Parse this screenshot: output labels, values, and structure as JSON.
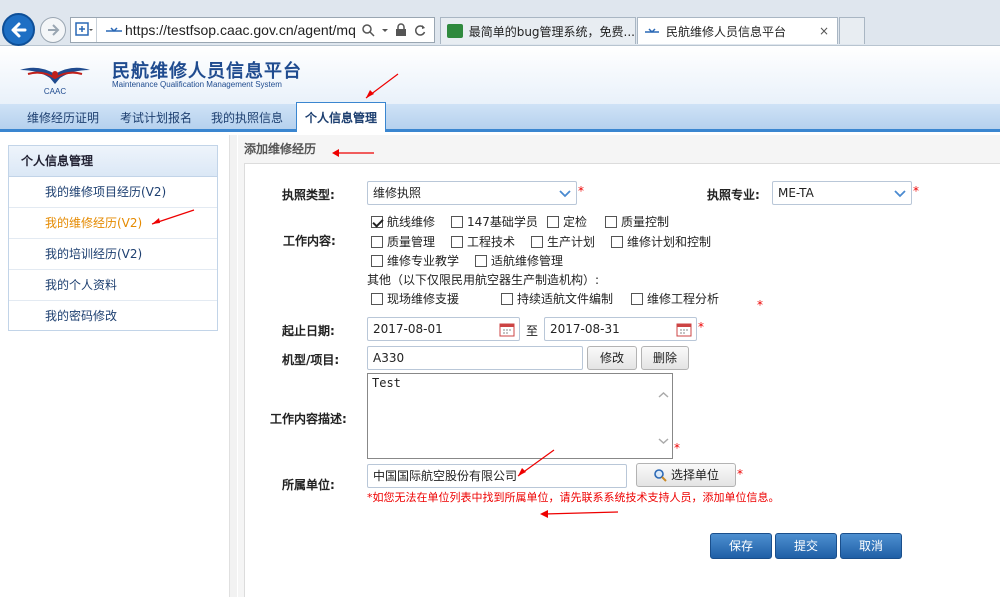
{
  "browser": {
    "url": "https://testfsop.caac.gov.cn/agent/mqms",
    "tabs": [
      {
        "title": "最简单的bug管理系统，免费..."
      },
      {
        "title": "民航维修人员信息平台",
        "close": "×"
      },
      {
        "title": ""
      }
    ]
  },
  "header": {
    "logo_text": "CAAC",
    "title": "民航维修人员信息平台",
    "subtitle": "Maintenance Qualification Management System"
  },
  "menu": {
    "items": [
      {
        "label": "维修经历证明"
      },
      {
        "label": "考试计划报名"
      },
      {
        "label": "我的执照信息"
      },
      {
        "label": "个人信息管理"
      }
    ]
  },
  "sidebar": {
    "heading": "个人信息管理",
    "items": [
      {
        "label": "我的维修项目经历(V2)"
      },
      {
        "label": "我的维修经历(V2)"
      },
      {
        "label": "我的培训经历(V2)"
      },
      {
        "label": "我的个人资料"
      },
      {
        "label": "我的密码修改"
      }
    ]
  },
  "page": {
    "title": "添加维修经历"
  },
  "form": {
    "license_type_label": "执照类型:",
    "license_type_value": "维修执照",
    "license_major_label": "执照专业:",
    "license_major_value": "ME-TA",
    "work_content_label": "工作内容:",
    "work_options": [
      {
        "label": "航线维修",
        "checked": true
      },
      {
        "label": "147基础学员",
        "checked": false
      },
      {
        "label": "定检",
        "checked": false
      },
      {
        "label": "质量控制",
        "checked": false
      },
      {
        "label": "质量管理",
        "checked": false
      },
      {
        "label": "工程技术",
        "checked": false
      },
      {
        "label": "生产计划",
        "checked": false
      },
      {
        "label": "维修计划和控制",
        "checked": false
      },
      {
        "label": "维修专业教学",
        "checked": false
      },
      {
        "label": "适航维修管理",
        "checked": false
      }
    ],
    "other_note": "其他（以下仅限民用航空器生产制造机构）:",
    "other_options": [
      {
        "label": "现场维修支援",
        "checked": false
      },
      {
        "label": "持续适航文件编制",
        "checked": false
      },
      {
        "label": "维修工程分析",
        "checked": false
      }
    ],
    "date_label": "起止日期:",
    "start_date": "2017-08-01",
    "date_sep": "至",
    "end_date": "2017-08-31",
    "model_label": "机型/项目:",
    "model_value": "A330",
    "edit_button": "修改",
    "delete_button": "删除",
    "desc_label": "工作内容描述:",
    "desc_value": "Test",
    "unit_label": "所属单位:",
    "unit_value": "中国国际航空股份有限公司",
    "select_unit_button": "选择单位",
    "unit_warning": "*如您无法在单位列表中找到所属单位，请先联系系统技术支持人员，添加单位信息。",
    "required_mark": "*",
    "save_button": "保存",
    "submit_button": "提交",
    "cancel_button": "取消"
  },
  "colors": {
    "accent": "#3a86d0",
    "active_sidebar": "#e58a00",
    "required": "#e00000",
    "button_primary": "#1f5fa6"
  }
}
